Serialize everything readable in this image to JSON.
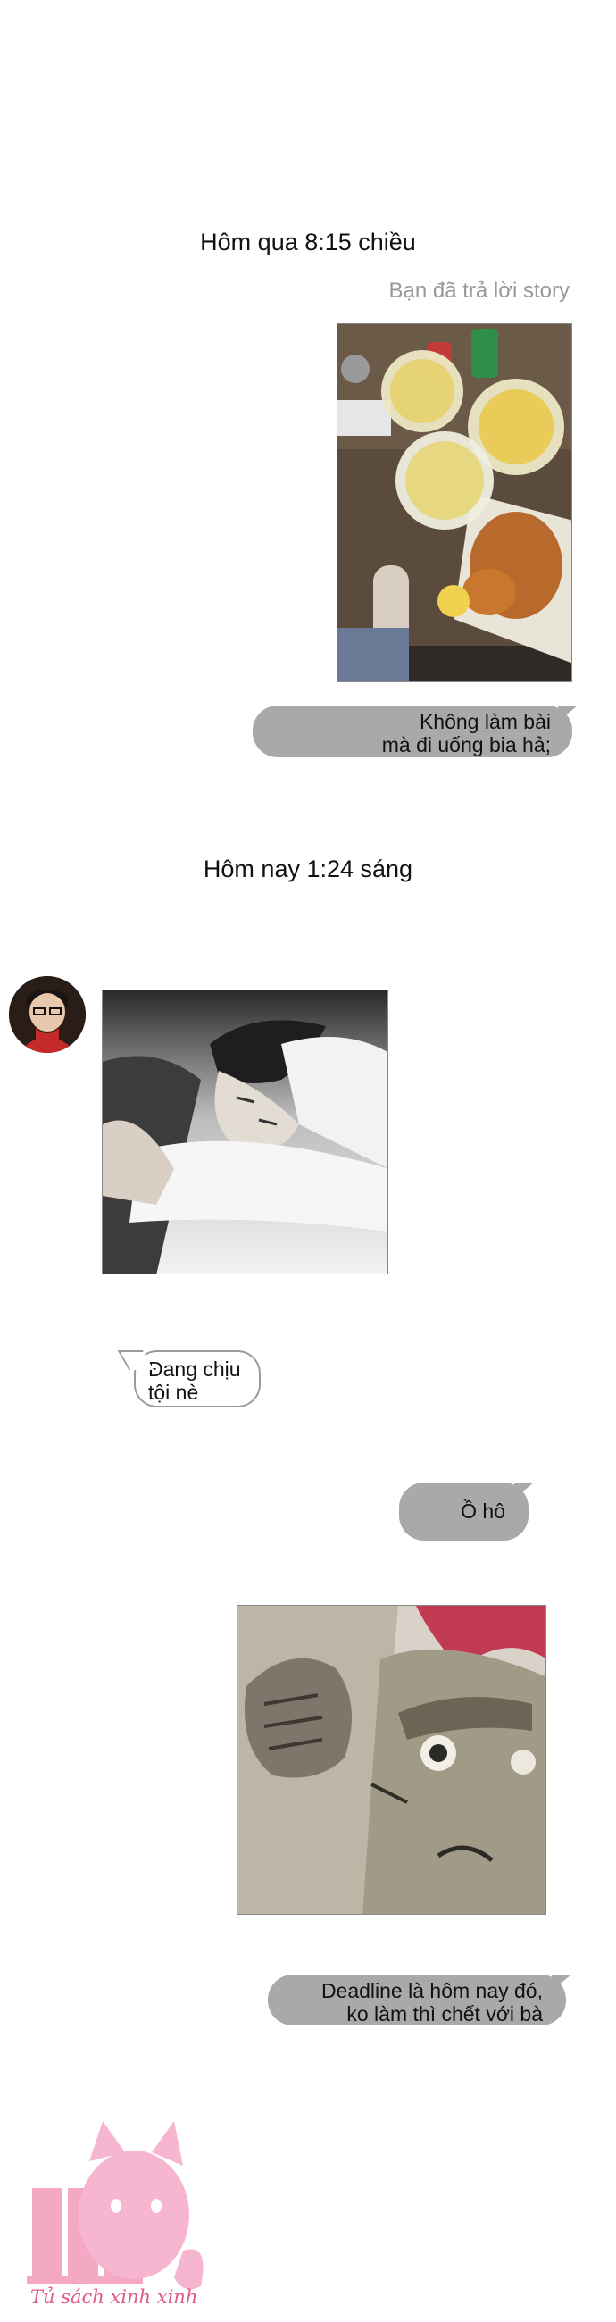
{
  "chat": {
    "timestamp_yesterday": "Hôm qua 8:15 chiều",
    "story_reply_note": "Bạn đã trả lời story",
    "msg_1_line_1": "Không làm bài",
    "msg_1_line_2": "mà đi uống bia hả;",
    "timestamp_today": "Hôm nay 1:24 sáng",
    "msg_2_line_1": "Đang chịu",
    "msg_2_line_2": "tội nè",
    "msg_3": "Ồ hô",
    "msg_4_line_1": "Deadline là hôm nay đó,",
    "msg_4_line_2": "ko làm thì chết với bà"
  },
  "watermark": {
    "text": "Tủ sách xinh xinh"
  },
  "colors": {
    "outgoing_bubble": "#a9a9a9",
    "incoming_border": "#9a9a9a",
    "watermark_pink": "#e05a8a"
  }
}
